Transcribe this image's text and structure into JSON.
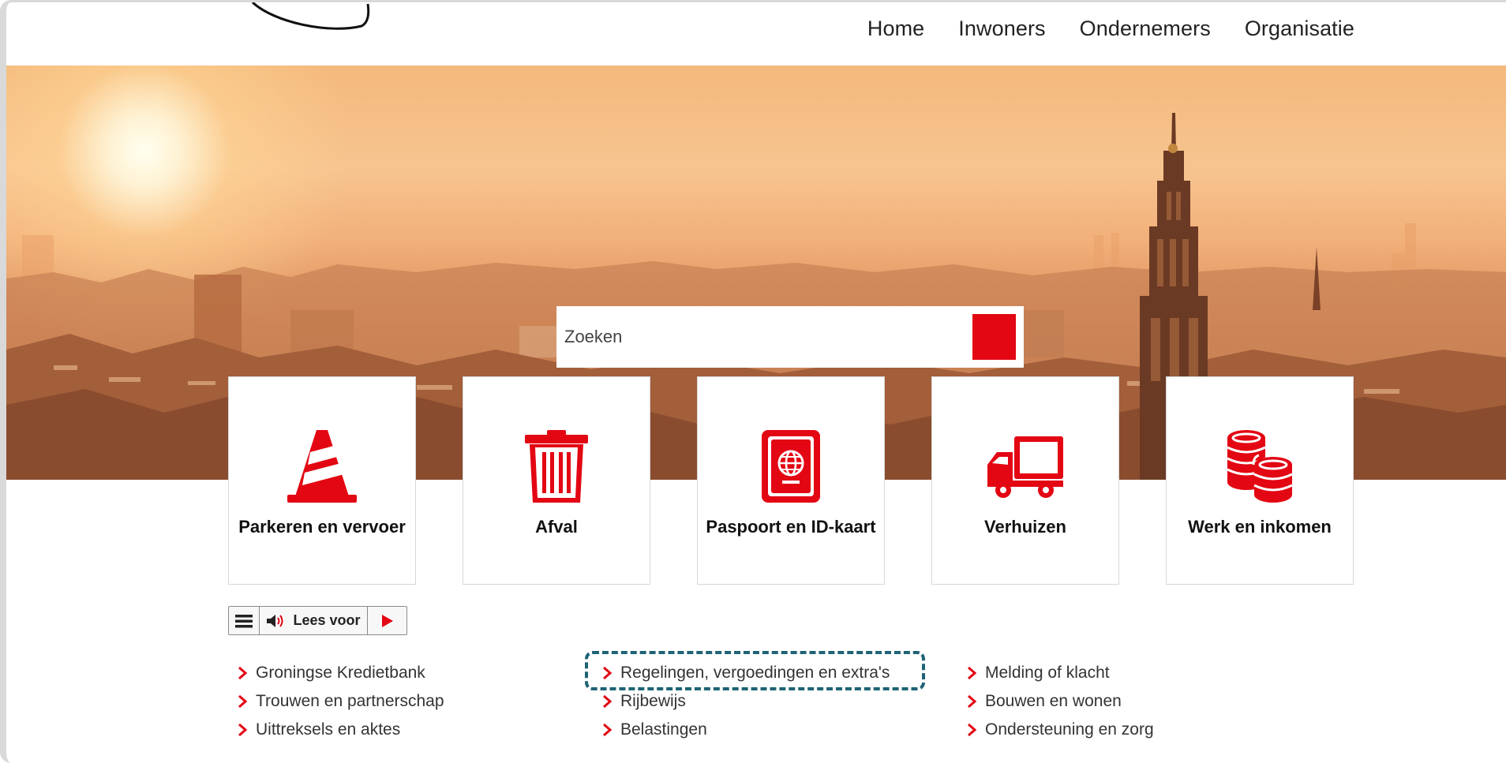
{
  "nav": {
    "items": [
      "Home",
      "Inwoners",
      "Ondernemers",
      "Organisatie"
    ]
  },
  "search": {
    "placeholder": "Zoeken"
  },
  "tiles": [
    {
      "label": "Parkeren en vervoer",
      "icon": "traffic-cone-icon"
    },
    {
      "label": "Afval",
      "icon": "trash-bin-icon"
    },
    {
      "label": "Paspoort en ID-kaart",
      "icon": "passport-icon"
    },
    {
      "label": "Verhuizen",
      "icon": "moving-truck-icon"
    },
    {
      "label": "Werk en inkomen",
      "icon": "coins-icon"
    }
  ],
  "readbar": {
    "label": "Lees voor"
  },
  "links": {
    "col1": [
      "Groningse Kredietbank",
      "Trouwen en partnerschap",
      "Uittreksels en aktes"
    ],
    "col2": [
      "Regelingen, vergoedingen en extra's",
      "Rijbewijs",
      "Belastingen"
    ],
    "col3": [
      "Melding of klacht",
      "Bouwen en wonen",
      "Ondersteuning en zorg"
    ]
  },
  "colors": {
    "accent": "#e30613",
    "highlight": "#1e6375"
  }
}
